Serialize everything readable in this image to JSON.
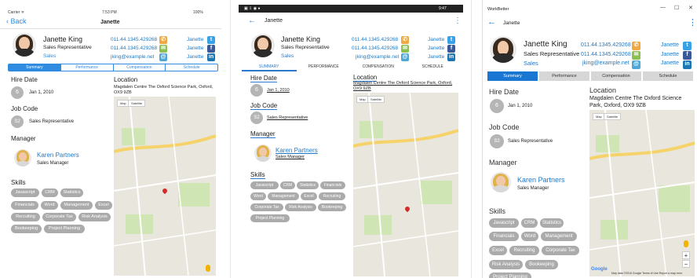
{
  "profile": {
    "name": "Janette King",
    "title": "Sales Representative",
    "department": "Sales",
    "phone1": "011.44.1345.429268",
    "phone2": "011.44.1345.429268",
    "email": "jking@example.net",
    "social_handle": "Janette",
    "hire_date": "Jan 1, 2010",
    "hire_badge": "6",
    "job_code": "Sales Representative",
    "job_badge": "S2",
    "manager_name": "Karen Partners",
    "manager_title": "Sales Manager",
    "location": "Magdalen Centre The Oxford Science Park, Oxford, OX9 9ZB",
    "skills": [
      "Javascript",
      "CRM",
      "Statistics",
      "Financials",
      "Word",
      "Management",
      "Excel",
      "Recruiting",
      "Corporate Tax",
      "Risk Analysis",
      "Bookeeping",
      "Project Planning"
    ]
  },
  "labels": {
    "hire_date": "Hire Date",
    "job_code": "Job Code",
    "manager": "Manager",
    "skills": "Skills",
    "location": "Location",
    "map_tab": "Map",
    "satellite_tab": "Satellite"
  },
  "ios": {
    "carrier": "Carrier ᯤ",
    "time": "7:53 PM",
    "battery": "100%",
    "back_label": "Back",
    "nav_title": "Janette",
    "tabs": [
      "Summary",
      "Performance",
      "Compensation",
      "Schedule"
    ],
    "selected_tab": "Summary"
  },
  "android": {
    "status_time": "9:47",
    "nav_title": "Janette",
    "tabs": [
      "SUMMARY",
      "PERFORMANCE",
      "COMPENSATION",
      "SCHEDULE"
    ],
    "selected_tab": "SUMMARY"
  },
  "windows": {
    "app_title": "WorkBetter",
    "nav_title": "Janette",
    "tabs": [
      "Summary",
      "Performance",
      "Compensation",
      "Schedule"
    ],
    "selected_tab": "Summary",
    "map_attribution": "Map data ©2016 Google   Terms of Use   Report a map error"
  },
  "map_labels": {
    "shopping": "Templars Square Shopping Centre",
    "road": "Cowley Road",
    "street": "Barns Road",
    "club": "Oxford United Football Club",
    "google": "Google"
  },
  "colors": {
    "ios_accent": "#2f8be0",
    "android_accent": "#2a7ad0",
    "win_accent": "#1976d2",
    "chip": "#ababab",
    "badge": "#b5b5b5",
    "road_major": "#f6d36a"
  }
}
